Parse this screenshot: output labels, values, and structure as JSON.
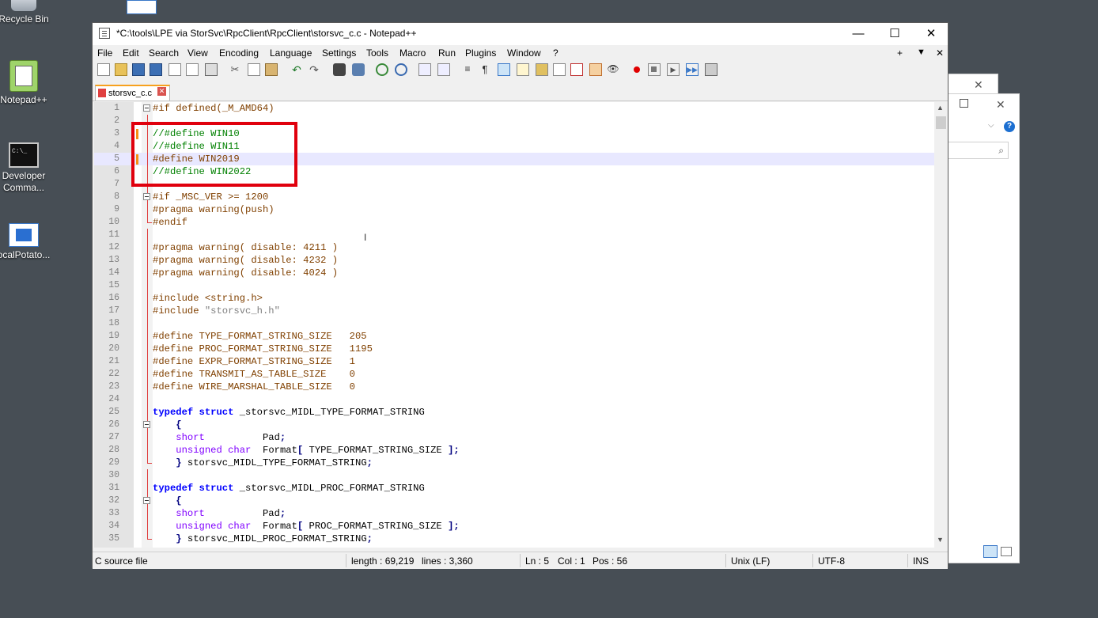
{
  "desktop": {
    "icons": [
      {
        "label": "Recycle Bin"
      },
      {
        "label": "Notepad++"
      },
      {
        "label": "Developer Comma..."
      },
      {
        "label": "ocalPotato..."
      }
    ]
  },
  "window": {
    "title": "*C:\\tools\\LPE via StorSvc\\RpcClient\\RpcClient\\storsvc_c.c - Notepad++",
    "controls": {
      "minimize": "—",
      "maximize": "☐",
      "close": "✕"
    }
  },
  "menu": {
    "items": [
      "File",
      "Edit",
      "Search",
      "View",
      "Encoding",
      "Language",
      "Settings",
      "Tools",
      "Macro",
      "Run",
      "Plugins",
      "Window",
      "?"
    ],
    "right": {
      "plus": "+",
      "down": "▼",
      "close": "✕"
    }
  },
  "tab": {
    "label": "storsvc_c.c",
    "close": "✕"
  },
  "editor": {
    "current_line": 5,
    "lines": [
      {
        "n": "1",
        "text": "#if defined(_M_AMD64)"
      },
      {
        "n": "2",
        "text": ""
      },
      {
        "n": "3",
        "text": "//#define WIN10"
      },
      {
        "n": "4",
        "text": "//#define WIN11"
      },
      {
        "n": "5",
        "text": "#define WIN2019"
      },
      {
        "n": "6",
        "text": "//#define WIN2022"
      },
      {
        "n": "7",
        "text": ""
      },
      {
        "n": "8",
        "text": "#if _MSC_VER >= 1200"
      },
      {
        "n": "9",
        "text": "#pragma warning(push)"
      },
      {
        "n": "10",
        "text": "#endif"
      },
      {
        "n": "11",
        "text": ""
      },
      {
        "n": "12",
        "text": "#pragma warning( disable: 4211 )"
      },
      {
        "n": "13",
        "text": "#pragma warning( disable: 4232 )"
      },
      {
        "n": "14",
        "text": "#pragma warning( disable: 4024 )"
      },
      {
        "n": "15",
        "text": ""
      },
      {
        "n": "16",
        "text": "#include <string.h>"
      },
      {
        "n": "17",
        "text": "#include \"storsvc_h.h\""
      },
      {
        "n": "18",
        "text": ""
      },
      {
        "n": "19",
        "text": "#define TYPE_FORMAT_STRING_SIZE   205"
      },
      {
        "n": "20",
        "text": "#define PROC_FORMAT_STRING_SIZE   1195"
      },
      {
        "n": "21",
        "text": "#define EXPR_FORMAT_STRING_SIZE   1"
      },
      {
        "n": "22",
        "text": "#define TRANSMIT_AS_TABLE_SIZE    0"
      },
      {
        "n": "23",
        "text": "#define WIRE_MARSHAL_TABLE_SIZE   0"
      },
      {
        "n": "24",
        "text": ""
      },
      {
        "n": "25",
        "text": "typedef struct _storsvc_MIDL_TYPE_FORMAT_STRING"
      },
      {
        "n": "26",
        "text": "    {"
      },
      {
        "n": "27",
        "text": "    short          Pad;"
      },
      {
        "n": "28",
        "text": "    unsigned char  Format[ TYPE_FORMAT_STRING_SIZE ];"
      },
      {
        "n": "29",
        "text": "    } storsvc_MIDL_TYPE_FORMAT_STRING;"
      },
      {
        "n": "30",
        "text": ""
      },
      {
        "n": "31",
        "text": "typedef struct _storsvc_MIDL_PROC_FORMAT_STRING"
      },
      {
        "n": "32",
        "text": "    {"
      },
      {
        "n": "33",
        "text": "    short          Pad;"
      },
      {
        "n": "34",
        "text": "    unsigned char  Format[ PROC_FORMAT_STRING_SIZE ];"
      },
      {
        "n": "35",
        "text": "    } storsvc_MIDL_PROC_FORMAT_STRING;"
      }
    ]
  },
  "status": {
    "filetype": "C source file",
    "length": "length : 69,219",
    "lines": "lines : 3,360",
    "ln": "Ln : 5",
    "col": "Col : 1",
    "pos": "Pos : 56",
    "eol": "Unix (LF)",
    "encoding": "UTF-8",
    "mode": "INS"
  },
  "colors": {
    "annotation_box": "#e0000d",
    "change_marker": "#f58e12",
    "comment": "#008000",
    "preprocessor": "#804000",
    "keyword": "#0000ff",
    "type": "#8000ff",
    "number": "#ff8000"
  }
}
